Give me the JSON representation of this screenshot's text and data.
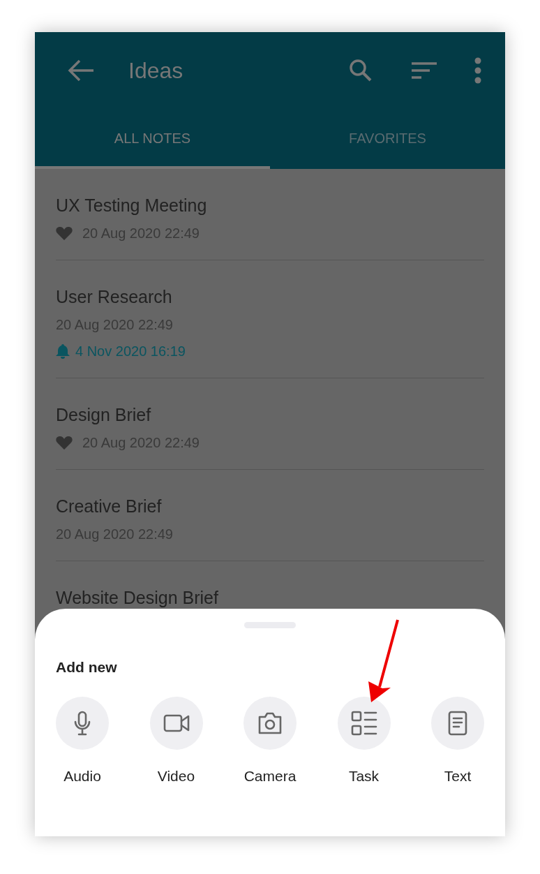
{
  "toolbar": {
    "title": "Ideas"
  },
  "tabs": [
    {
      "label": "ALL NOTES",
      "selected": true
    },
    {
      "label": "FAVORITES",
      "selected": false
    }
  ],
  "notes": [
    {
      "title": "UX Testing Meeting",
      "favorite": true,
      "date": "20 Aug 2020 22:49"
    },
    {
      "title": "User Research",
      "favorite": false,
      "date": "20 Aug 2020 22:49",
      "reminder": "4 Nov 2020 16:19"
    },
    {
      "title": "Design Brief",
      "favorite": true,
      "date": "20 Aug 2020 22:49"
    },
    {
      "title": "Creative Brief",
      "favorite": false,
      "date": "20 Aug 2020 22:49"
    },
    {
      "title": "Website Design Brief"
    }
  ],
  "sheet": {
    "title": "Add new",
    "options": [
      {
        "kind": "audio",
        "label": "Audio"
      },
      {
        "kind": "video",
        "label": "Video"
      },
      {
        "kind": "camera",
        "label": "Camera"
      },
      {
        "kind": "task",
        "label": "Task"
      },
      {
        "kind": "text",
        "label": "Text"
      }
    ]
  }
}
